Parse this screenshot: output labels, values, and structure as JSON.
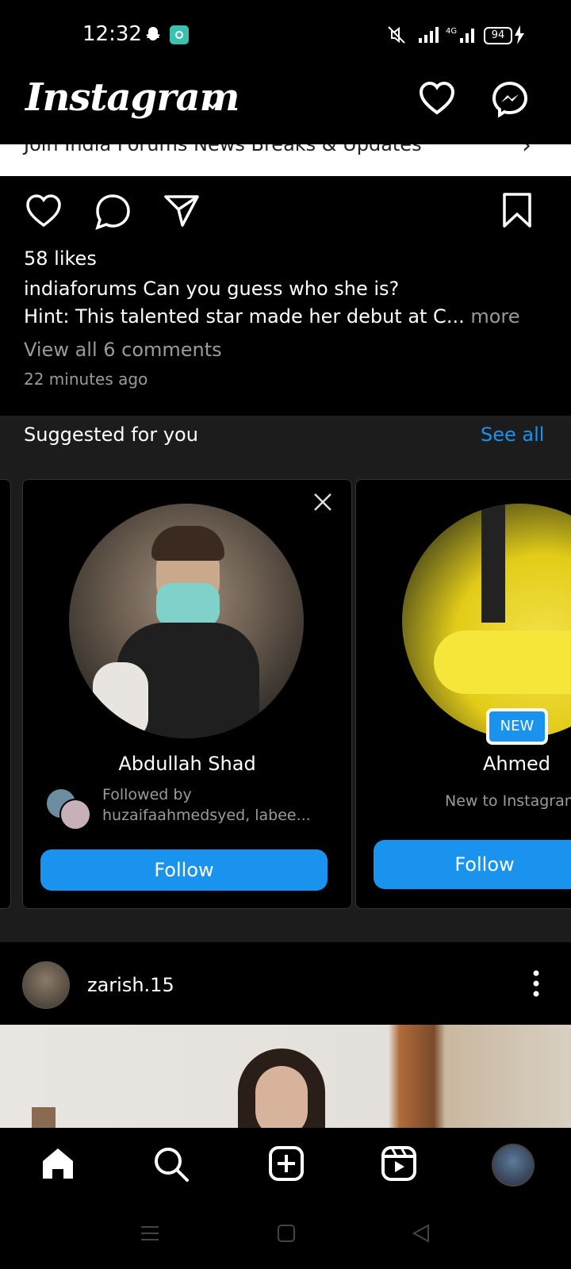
{
  "status_bar": {
    "time": "12:32",
    "battery": "94",
    "network": "4G"
  },
  "header": {
    "logo": "Instagram",
    "dropdown_icon": "chevron-down-icon"
  },
  "ad": {
    "text": "Join India Forums News Breaks & Updates"
  },
  "post": {
    "likes": "58 likes",
    "caption_user": "indiaforums",
    "caption_line1": "Can you guess who she is?",
    "caption_line2": "Hint: This talented star made her debut at C...",
    "more": "more",
    "comments_link": "View all 6 comments",
    "time": "22 minutes ago"
  },
  "suggested": {
    "title": "Suggested for you",
    "see_all": "See all",
    "cards": [
      {
        "name": "Abdullah Shad",
        "sub_label": "Followed by",
        "sub_names": "huzaifaahmedsyed, labee...",
        "button": "Follow"
      },
      {
        "name": "Ahmed",
        "badge": "NEW",
        "sub": "New to Instagram",
        "button": "Follow"
      }
    ]
  },
  "next_post": {
    "username": "zarish.15"
  },
  "colors": {
    "accent": "#1a93ef",
    "background": "#000000",
    "panel": "#1c1c1c"
  }
}
